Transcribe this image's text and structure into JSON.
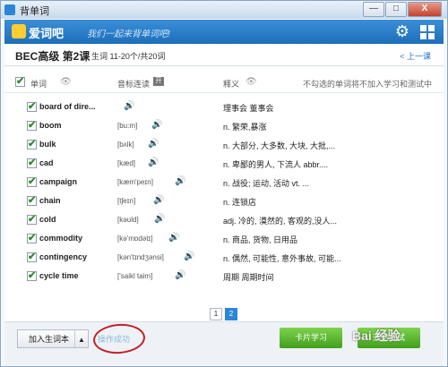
{
  "window": {
    "title": "背单词",
    "min_label": "—",
    "max_label": "□",
    "close_label": "X"
  },
  "header": {
    "logo_text": "爱词吧",
    "slogan": "我们一起来背单词吧!"
  },
  "topbar": {
    "course": "BEC高级 第2课",
    "range": "生词 11-20个/共20词",
    "prev": "< 上一课"
  },
  "columns": {
    "word": "单词",
    "phonetic": "音标连读",
    "def": "释义",
    "note": "不勾选的单词将不加入学习和测试中"
  },
  "words": [
    {
      "word": "board of dire...",
      "phonetic": "",
      "def": "理事会 董事会"
    },
    {
      "word": "boom",
      "phonetic": "[bu:m]",
      "def": "n. 繁荣,暴涨"
    },
    {
      "word": "bulk",
      "phonetic": "[bʌlk]",
      "def": "n. 大部分, 大多数, 大块, 大批,..."
    },
    {
      "word": "cad",
      "phonetic": "[kæd]",
      "def": "n. 卑鄙的男人, 下流人 abbr...."
    },
    {
      "word": "campaign",
      "phonetic": "[kæm'peɪn]",
      "def": "n. 战役; 运动, 活动 vt. ..."
    },
    {
      "word": "chain",
      "phonetic": "[tʃeɪn]",
      "def": "n. 连锁店"
    },
    {
      "word": "cold",
      "phonetic": "[kəʊld]",
      "def": "adj. 冷的, 漠然的, 客观的,没人..."
    },
    {
      "word": "commodity",
      "phonetic": "[kə'mɒdətɪ]",
      "def": "n. 商品, 货物, 日用品"
    },
    {
      "word": "contingency",
      "phonetic": "[kən'tɪndʒənsi]",
      "def": "n. 偶然, 可能性, 意外事故, 可能..."
    },
    {
      "word": "cycle time",
      "phonetic": "['saikl taim]",
      "def": "周期 周期时间"
    }
  ],
  "pager": {
    "page1": "1",
    "page2": "2"
  },
  "footer": {
    "add_label": "加入生词本",
    "add_arrow": "▲",
    "status": "操作成功",
    "card_label": "卡片学习",
    "test_label": "开始测试",
    "watermark": "Bai 经验"
  }
}
